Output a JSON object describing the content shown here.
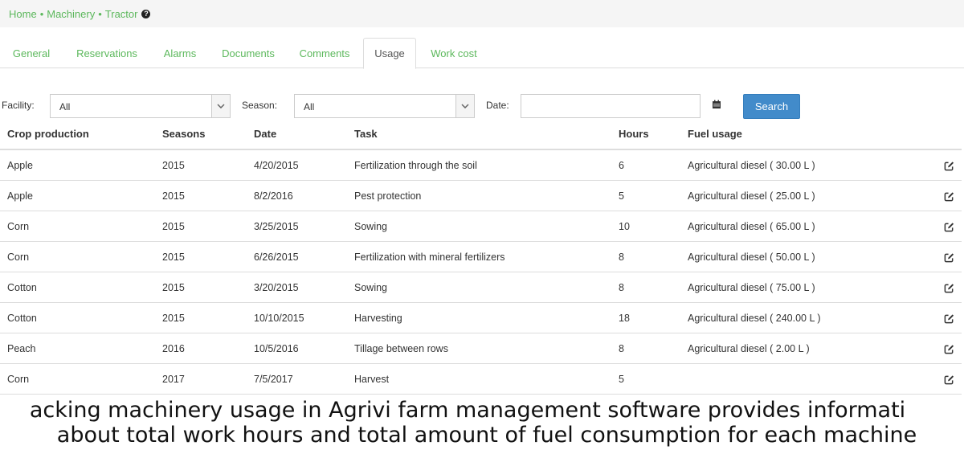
{
  "breadcrumb": {
    "items": [
      "Home",
      "Machinery",
      "Tractor"
    ],
    "separator": "•"
  },
  "tabs": [
    {
      "label": "General",
      "active": false
    },
    {
      "label": "Reservations",
      "active": false
    },
    {
      "label": "Alarms",
      "active": false
    },
    {
      "label": "Documents",
      "active": false
    },
    {
      "label": "Comments",
      "active": false
    },
    {
      "label": "Usage",
      "active": true
    },
    {
      "label": "Work cost",
      "active": false
    }
  ],
  "filters": {
    "facility_label": "Facility:",
    "facility_value": "All",
    "season_label": "Season:",
    "season_value": "All",
    "date_label": "Date:",
    "date_value": "",
    "search_label": "Search"
  },
  "table": {
    "headers": [
      "Crop production",
      "Seasons",
      "Date",
      "Task",
      "Hours",
      "Fuel usage"
    ],
    "rows": [
      [
        "Apple",
        "2015",
        "4/20/2015",
        "Fertilization through the soil",
        "6",
        "Agricultural diesel ( 30.00 L )"
      ],
      [
        "Apple",
        "2015",
        "8/2/2016",
        "Pest protection",
        "5",
        "Agricultural diesel ( 25.00 L )"
      ],
      [
        "Corn",
        "2015",
        "3/25/2015",
        "Sowing",
        "10",
        "Agricultural diesel ( 65.00 L )"
      ],
      [
        "Corn",
        "2015",
        "6/26/2015",
        "Fertilization with mineral fertilizers",
        "8",
        "Agricultural diesel ( 50.00 L )"
      ],
      [
        "Cotton",
        "2015",
        "3/20/2015",
        "Sowing",
        "8",
        "Agricultural diesel ( 75.00 L )"
      ],
      [
        "Cotton",
        "2015",
        "10/10/2015",
        "Harvesting",
        "18",
        "Agricultural diesel ( 240.00 L )"
      ],
      [
        "Peach",
        "2016",
        "10/5/2016",
        "Tillage between rows",
        "8",
        "Agricultural diesel ( 2.00 L )"
      ],
      [
        "Corn",
        "2017",
        "7/5/2017",
        "Harvest",
        "5",
        ""
      ]
    ]
  },
  "caption": {
    "line1": "acking machinery usage in Agrivi farm management software provides informati",
    "line2": "about total work hours and total amount of fuel consumption for each machine"
  },
  "colors": {
    "link_green": "#5cb85c",
    "search_blue": "#428bca",
    "border_gray": "#dddddd"
  },
  "icons": [
    "help-icon",
    "chevron-down-icon",
    "calendar-icon",
    "edit-icon"
  ]
}
